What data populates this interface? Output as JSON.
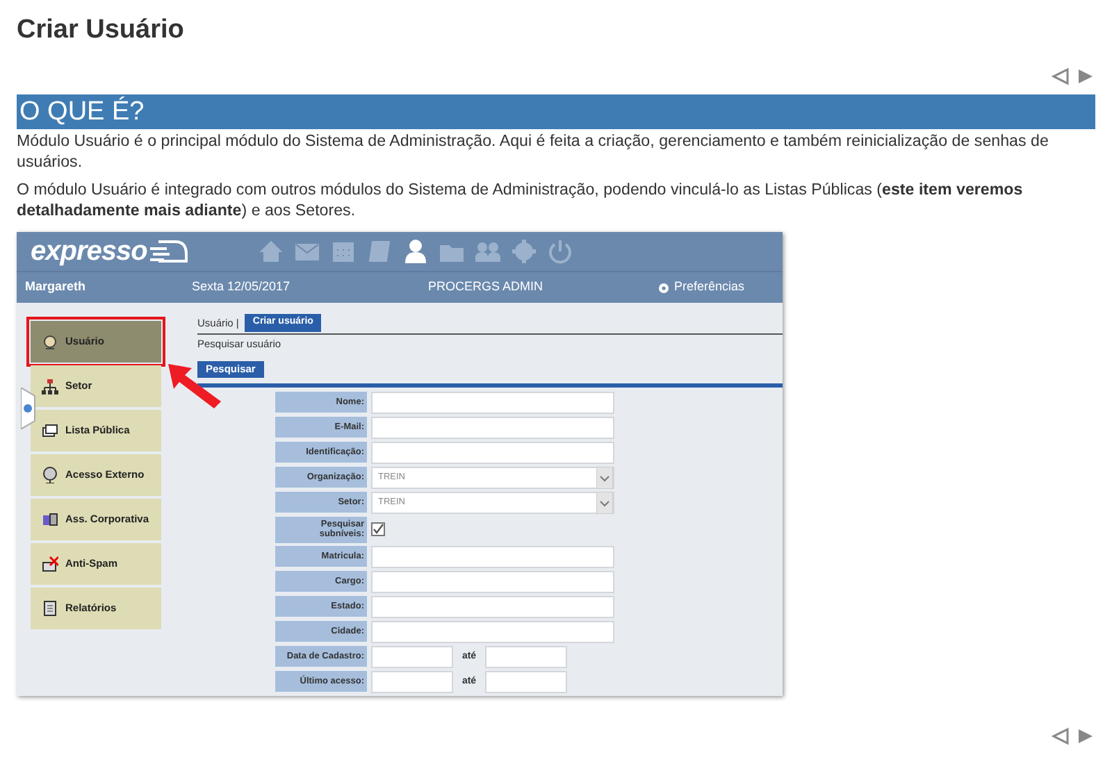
{
  "page": {
    "title": "Criar Usuário"
  },
  "section": {
    "heading": "O QUE É?",
    "paragraphs": [
      "Módulo Usuário é o principal módulo do Sistema de Administração. Aqui é feita a criação, gerenciamento e também reinicialização de senhas de usuários.",
      "O módulo Usuário é integrado com outros módulos do Sistema de Administração, podendo vinculá-lo as Listas Públicas (**este item veremos detalhadamente mais adiante**) e aos Setores."
    ]
  },
  "screenshot": {
    "logo": "expresso",
    "toolbar": [
      {
        "selected": false
      },
      {
        "selected": false
      },
      {
        "selected": false
      },
      {
        "selected": false
      },
      {
        "selected": true
      },
      {
        "selected": false
      },
      {
        "selected": false
      },
      {
        "selected": false
      },
      {
        "selected": false
      }
    ],
    "user": "Margareth",
    "date": "Sexta 12/05/2017",
    "organization": "PROCERGS ADMIN",
    "preferences": "Preferências",
    "sidebar": [
      {
        "label": "Usuário",
        "selected": true,
        "highlighted": true
      },
      {
        "label": "Setor",
        "selected": false,
        "highlighted": false
      },
      {
        "label": "Lista Pública",
        "selected": false,
        "highlighted": false
      },
      {
        "label": "Acesso Externo",
        "selected": false,
        "highlighted": false
      },
      {
        "label": "Ass. Corporativa",
        "selected": false,
        "highlighted": false
      },
      {
        "label": "Anti-Spam",
        "selected": false,
        "highlighted": false
      },
      {
        "label": "Relatórios",
        "selected": false,
        "highlighted": false
      }
    ],
    "breadcrumb": "Usuário |",
    "tab": "Criar usuário",
    "search_title": "Pesquisar usuário",
    "search_button": "Pesquisar",
    "form": [
      {
        "kind": "text",
        "label": "Nome:"
      },
      {
        "kind": "text",
        "label": "E-Mail:"
      },
      {
        "kind": "text",
        "label": "Identificação:"
      },
      {
        "kind": "select",
        "label": "Organização:",
        "value": "TREIN"
      },
      {
        "kind": "select",
        "label": "Setor:",
        "value": "TREIN"
      },
      {
        "kind": "checkbox",
        "label": "Pesquisar subníveis:",
        "checked": true
      },
      {
        "kind": "text",
        "label": "Matricula:"
      },
      {
        "kind": "text",
        "label": "Cargo:"
      },
      {
        "kind": "text",
        "label": "Estado:"
      },
      {
        "kind": "text",
        "label": "Cidade:"
      },
      {
        "kind": "range",
        "label": "Data de Cadastro:",
        "separator": "até"
      },
      {
        "kind": "range",
        "label": "Último acesso:",
        "separator": "até"
      }
    ]
  }
}
